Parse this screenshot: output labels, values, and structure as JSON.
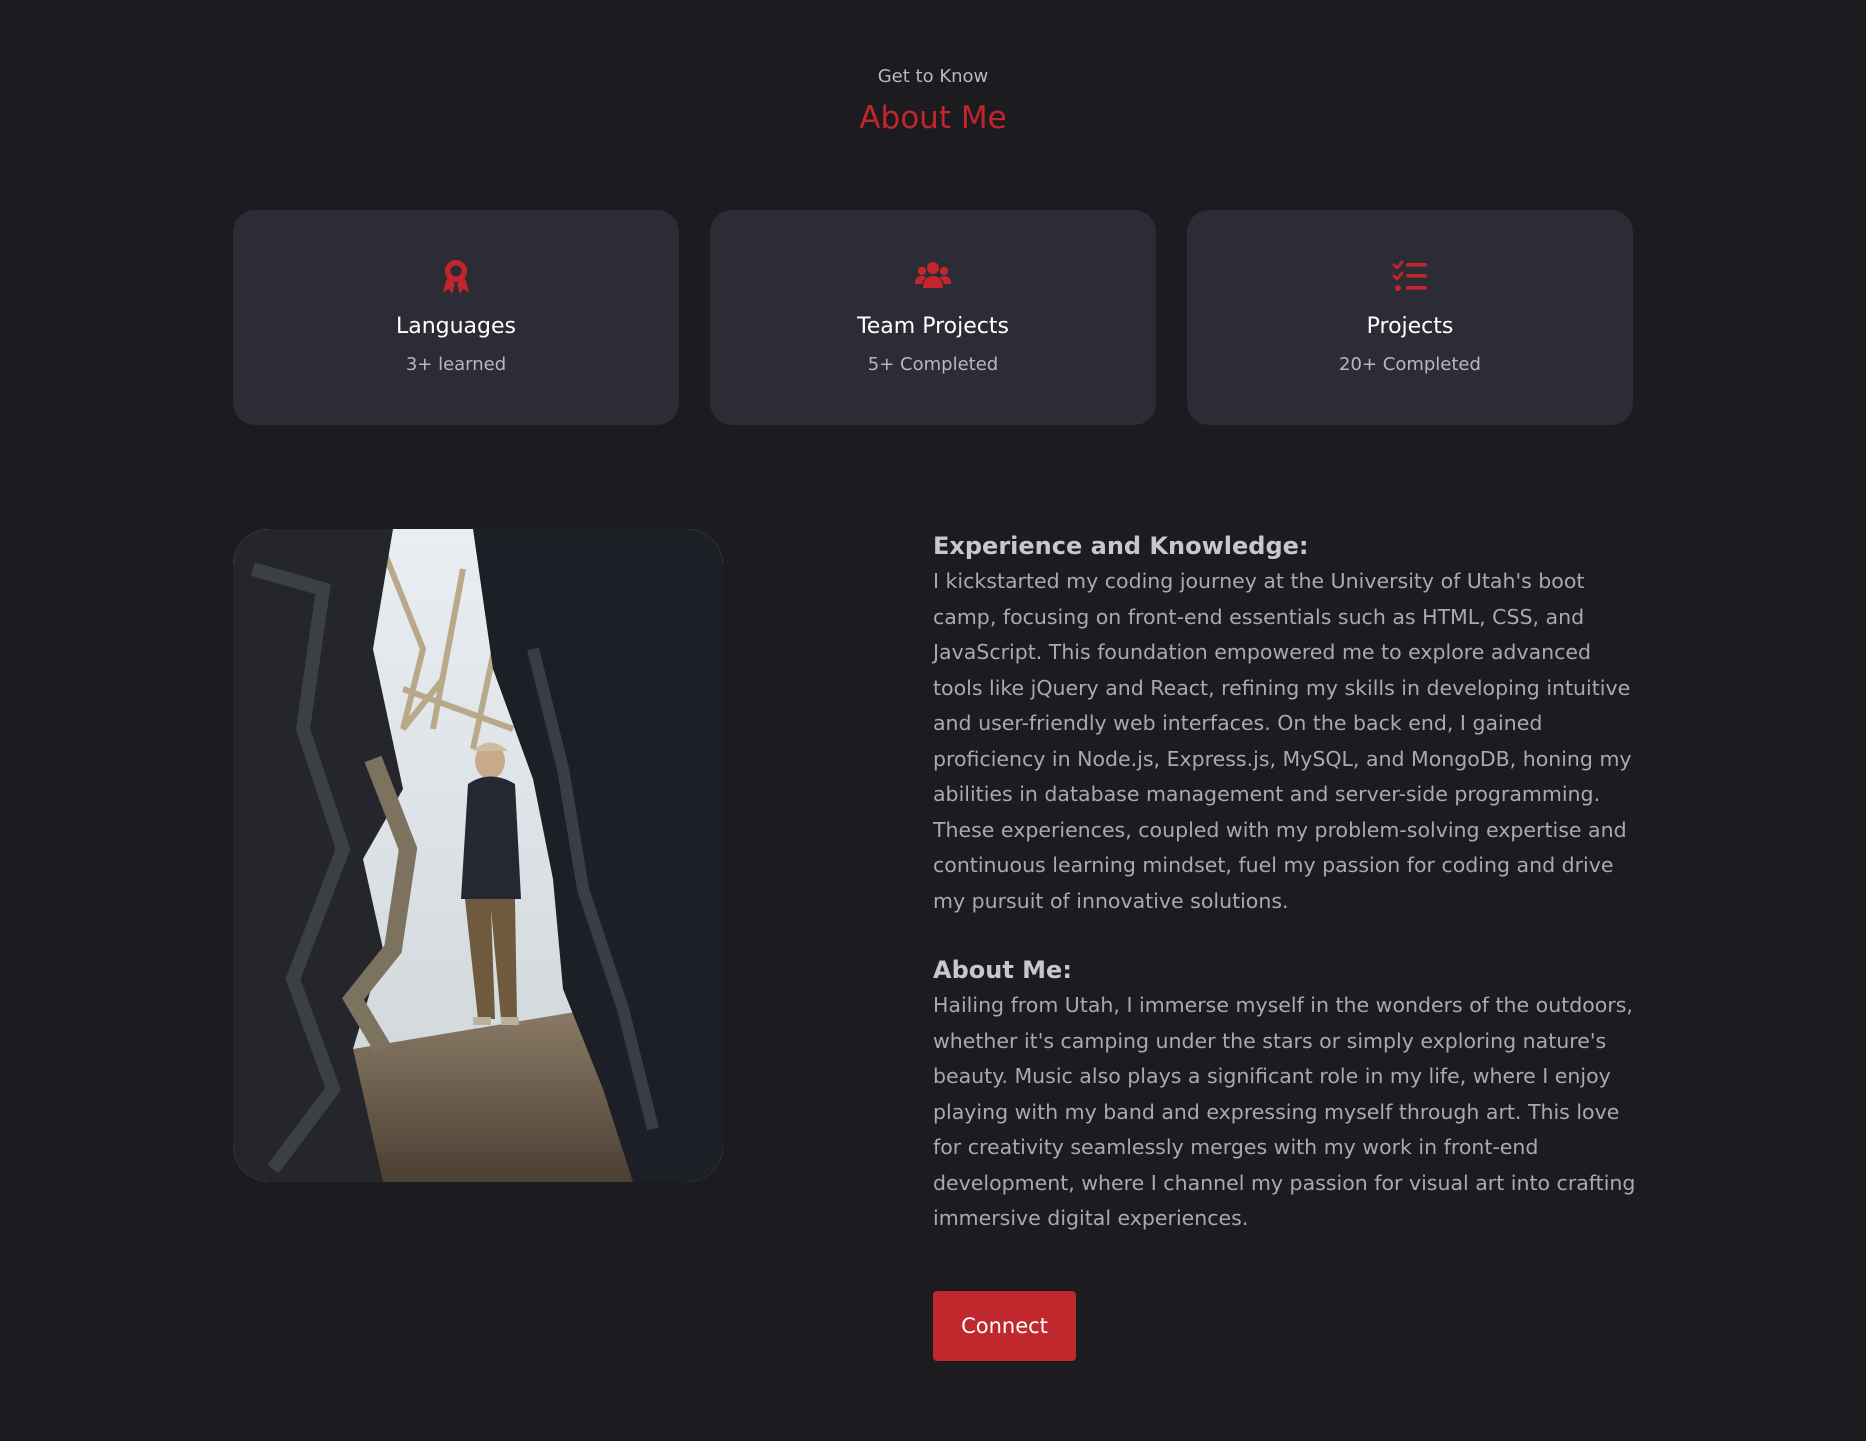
{
  "header": {
    "eyebrow": "Get to Know",
    "title": "About Me"
  },
  "cards": [
    {
      "icon": "award-icon",
      "title": "Languages",
      "subtitle": "3+ learned"
    },
    {
      "icon": "users-icon",
      "title": "Team Projects",
      "subtitle": "5+ Completed"
    },
    {
      "icon": "list-check-icon",
      "title": "Projects",
      "subtitle": "20+ Completed"
    }
  ],
  "photo": {
    "icon": "profile-photo"
  },
  "experience": {
    "heading": "Experience and Knowledge:",
    "body": "I kickstarted my coding journey at the University of Utah's boot camp, focusing on front-end essentials such as HTML, CSS, and JavaScript. This foundation empowered me to explore advanced tools like jQuery and React, refining my skills in developing intuitive and user-friendly web interfaces. On the back end, I gained proficiency in Node.js, Express.js, MySQL, and MongoDB, honing my abilities in database management and server-side programming. These experiences, coupled with my problem-solving expertise and continuous learning mindset, fuel my passion for coding and drive my pursuit of innovative solutions."
  },
  "about": {
    "heading": "About Me:",
    "body": "Hailing from Utah, I immerse myself in the wonders of the outdoors, whether it's camping under the stars or simply exploring nature's beauty. Music also plays a significant role in my life, where I enjoy playing with my band and expressing myself through art. This love for creativity seamlessly merges with my work in front-end development, where I channel my passion for visual art into crafting immersive digital experiences."
  },
  "actions": {
    "connect_label": "Connect"
  },
  "colors": {
    "background": "#1b1b20",
    "card": "#2c2c36",
    "accent": "#c2262c"
  }
}
